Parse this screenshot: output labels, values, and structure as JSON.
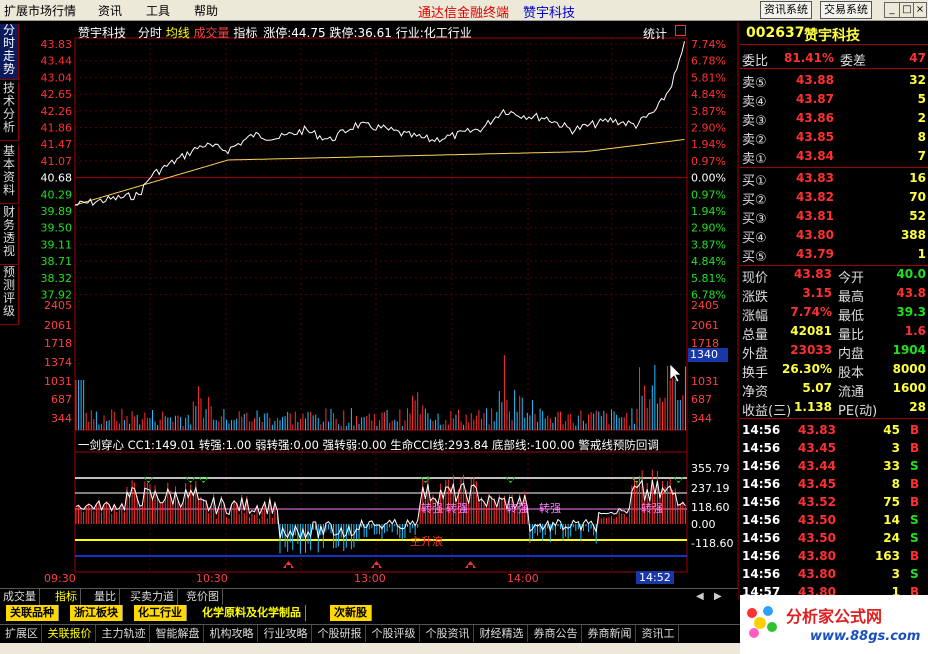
{
  "menubar": {
    "items": [
      "扩展市场行情",
      "资讯",
      "工具",
      "帮助"
    ],
    "app_title": "通达信金融终端",
    "stock_title": "赞宇科技",
    "buttons": [
      "资讯系统",
      "交易系统"
    ],
    "win_controls": [
      "_",
      "□",
      "×"
    ]
  },
  "left_tabs": [
    "分时走势",
    "技术分析",
    "基本资料",
    "财务透视",
    "预测评级"
  ],
  "chart_header": {
    "name": "赞宇科技",
    "items": [
      {
        "text": "分时",
        "color": "#ffffff"
      },
      {
        "text": "均线",
        "color": "#ffff00"
      },
      {
        "text": "成交量",
        "color": "#ff4040"
      },
      {
        "text": "指标",
        "color": "#ffffff"
      }
    ],
    "limit_up": "涨停:44.75",
    "limit_down": "跌停:36.61",
    "industry": "行业:化工行业",
    "stats": "统计"
  },
  "price_axis": {
    "left": [
      "43.83",
      "43.44",
      "43.04",
      "42.65",
      "42.26",
      "41.86",
      "41.47",
      "41.07",
      "40.68",
      "40.29",
      "39.89",
      "39.50",
      "39.11",
      "38.71",
      "38.32",
      "37.92"
    ],
    "right": [
      "7.74%",
      "6.78%",
      "5.81%",
      "4.84%",
      "3.87%",
      "2.90%",
      "1.94%",
      "0.97%",
      "0.00%",
      "0.97%",
      "1.94%",
      "2.90%",
      "3.87%",
      "4.84%",
      "5.81%",
      "6.78%"
    ],
    "colors": {
      "up": "#ff3030",
      "flat": "#ffffff",
      "down": "#20e020"
    }
  },
  "volume_axis": {
    "labels": [
      "2405",
      "2061",
      "1718",
      "1374",
      "1031",
      "687",
      "344"
    ],
    "right_labels": [
      "2405",
      "2061",
      "1718",
      "1031",
      "687",
      "344"
    ],
    "current": "1340"
  },
  "indicator": {
    "header": [
      {
        "text": "一剑穿心",
        "color": "#ffffff"
      },
      {
        "text": "CC1:149.01",
        "color": "#ffffff"
      },
      {
        "text": "转强:1.00",
        "color": "#ffffff"
      },
      {
        "text": "弱转强:0.00",
        "color": "#ffffff"
      },
      {
        "text": "强转弱:0.00",
        "color": "#ffffff"
      },
      {
        "text": "生命CCI线:293.84",
        "color": "#ffffff"
      },
      {
        "text": "底部线:-100.00",
        "color": "#ffffff"
      },
      {
        "text": "警戒线预防回调",
        "color": "#ffffff"
      }
    ],
    "right_labels": [
      "355.79",
      "237.19",
      "118.60",
      "0.00",
      "-118.60"
    ],
    "annotations": [
      "转强",
      "转强",
      "转强",
      "转强",
      "转强",
      "主升浪"
    ]
  },
  "time_axis": {
    "labels": [
      "09:30",
      "10:30",
      "13:00",
      "14:00"
    ],
    "current": "14:52"
  },
  "quote": {
    "code": "002637",
    "name": "赞宇科技",
    "ratio_label": "委比",
    "ratio_value": "81.41%",
    "diff_label": "委差",
    "diff_value": "47",
    "asks": [
      {
        "label": "卖⑤",
        "price": "43.88",
        "vol": "32"
      },
      {
        "label": "卖④",
        "price": "43.87",
        "vol": "5"
      },
      {
        "label": "卖③",
        "price": "43.86",
        "vol": "2"
      },
      {
        "label": "卖②",
        "price": "43.85",
        "vol": "8"
      },
      {
        "label": "卖①",
        "price": "43.84",
        "vol": "7"
      }
    ],
    "bids": [
      {
        "label": "买①",
        "price": "43.83",
        "vol": "16"
      },
      {
        "label": "买②",
        "price": "43.82",
        "vol": "70"
      },
      {
        "label": "买③",
        "price": "43.81",
        "vol": "52"
      },
      {
        "label": "买④",
        "price": "43.80",
        "vol": "388"
      },
      {
        "label": "买⑤",
        "price": "43.79",
        "vol": "1"
      }
    ],
    "stats": [
      {
        "l1": "现价",
        "v1": "43.83",
        "c1": "#ff3030",
        "l2": "今开",
        "v2": "40.0",
        "c2": "#20e020"
      },
      {
        "l1": "涨跌",
        "v1": "3.15",
        "c1": "#ff3030",
        "l2": "最高",
        "v2": "43.8",
        "c2": "#ff3030"
      },
      {
        "l1": "涨幅",
        "v1": "7.74%",
        "c1": "#ff3030",
        "l2": "最低",
        "v2": "39.3",
        "c2": "#20e020"
      },
      {
        "l1": "总量",
        "v1": "42081",
        "c1": "#ffff40",
        "l2": "量比",
        "v2": "1.6",
        "c2": "#ff3030"
      },
      {
        "l1": "外盘",
        "v1": "23033",
        "c1": "#ff3030",
        "l2": "内盘",
        "v2": "1904",
        "c2": "#20e020"
      },
      {
        "l1": "换手",
        "v1": "26.30%",
        "c1": "#ffff40",
        "l2": "股本",
        "v2": "8000",
        "c2": "#ffff40"
      },
      {
        "l1": "净资",
        "v1": "5.07",
        "c1": "#ffff40",
        "l2": "流通",
        "v2": "1600",
        "c2": "#ffff40"
      },
      {
        "l1": "收益(三)",
        "v1": "1.138",
        "c1": "#ffff40",
        "l2": "PE(动)",
        "v2": "28",
        "c2": "#ffff40"
      }
    ],
    "ticks": [
      {
        "time": "14:56",
        "price": "43.83",
        "vol": "45",
        "side": "B"
      },
      {
        "time": "14:56",
        "price": "43.45",
        "vol": "3",
        "side": "B"
      },
      {
        "time": "14:56",
        "price": "43.44",
        "vol": "33",
        "side": "S"
      },
      {
        "time": "14:56",
        "price": "43.45",
        "vol": "8",
        "side": "B"
      },
      {
        "time": "14:56",
        "price": "43.52",
        "vol": "75",
        "side": "B"
      },
      {
        "time": "14:56",
        "price": "43.50",
        "vol": "14",
        "side": "S"
      },
      {
        "time": "14:56",
        "price": "43.50",
        "vol": "24",
        "side": "S"
      },
      {
        "time": "14:56",
        "price": "43.80",
        "vol": "163",
        "side": "B"
      },
      {
        "time": "14:56",
        "price": "43.80",
        "vol": "3",
        "side": "S"
      },
      {
        "time": "14:57",
        "price": "43.80",
        "vol": "1",
        "side": "B"
      }
    ]
  },
  "sub_tabs": [
    "成交量",
    "指标",
    "量比",
    "买卖力道",
    "竞价图"
  ],
  "sector_tabs": [
    "关联品种",
    "浙江板块",
    "化工行业",
    "化学原料及化学制品",
    "次新股"
  ],
  "bottom_nav": [
    "扩展区",
    "关联报价",
    "主力轨迹",
    "智能解盘",
    "机构攻略",
    "行业攻略",
    "个股研报",
    "个股评级",
    "个股资讯",
    "财经精选",
    "券商公告",
    "券商新闻",
    "资讯工"
  ],
  "logo": {
    "title": "分析家公式网",
    "url": "www.88gs.com"
  }
}
